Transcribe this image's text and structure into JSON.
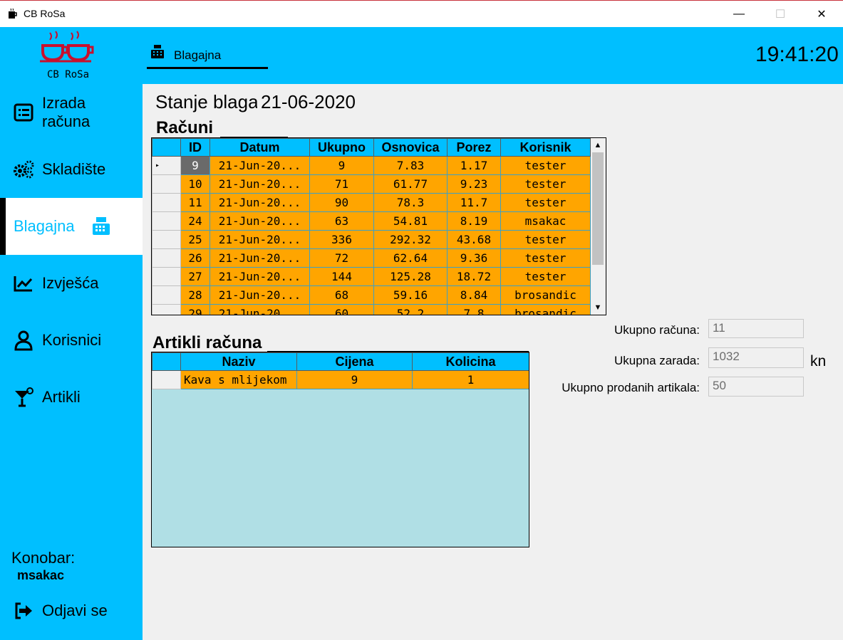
{
  "window": {
    "title": "CB RoSa",
    "minimize": "—",
    "maximize": "☐",
    "close": "✕"
  },
  "logo": {
    "text": "CB RoSa"
  },
  "sidebar": {
    "items": [
      {
        "label_line1": "Izrada",
        "label_line2": "računa",
        "icon": "list-icon"
      },
      {
        "label": "Skladište",
        "icon": "gears-icon"
      },
      {
        "label": "Blagajna",
        "icon": "cash-register-icon",
        "active": true
      },
      {
        "label": "Izvješća",
        "icon": "chart-icon"
      },
      {
        "label": "Korisnici",
        "icon": "user-icon"
      },
      {
        "label": "Artikli",
        "icon": "cocktail-icon"
      }
    ],
    "waiter_label": "Konobar:",
    "waiter_name": "msakac",
    "logout_label": "Odjavi se"
  },
  "header": {
    "tab_label": "Blagajna",
    "clock": "19:41:20"
  },
  "main": {
    "stanje_label": "Stanje blaga",
    "date": "21-06-2020",
    "racuni_title": "Računi",
    "racuni_columns": [
      "ID",
      "Datum",
      "Ukupno",
      "Osnovica",
      "Porez",
      "Korisnik"
    ],
    "racuni_rows": [
      [
        "9",
        "21-Jun-20...",
        "9",
        "7.83",
        "1.17",
        "tester"
      ],
      [
        "10",
        "21-Jun-20...",
        "71",
        "61.77",
        "9.23",
        "tester"
      ],
      [
        "11",
        "21-Jun-20...",
        "90",
        "78.3",
        "11.7",
        "tester"
      ],
      [
        "24",
        "21-Jun-20...",
        "63",
        "54.81",
        "8.19",
        "msakac"
      ],
      [
        "25",
        "21-Jun-20...",
        "336",
        "292.32",
        "43.68",
        "tester"
      ],
      [
        "26",
        "21-Jun-20...",
        "72",
        "62.64",
        "9.36",
        "tester"
      ],
      [
        "27",
        "21-Jun-20...",
        "144",
        "125.28",
        "18.72",
        "tester"
      ],
      [
        "28",
        "21-Jun-20...",
        "68",
        "59.16",
        "8.84",
        "brosandic"
      ],
      [
        "29",
        "21-Jun-20...",
        "60",
        "52.2",
        "7.8",
        "brosandic"
      ]
    ],
    "artikli_title": "Artikli računa",
    "artikli_columns": [
      "Naziv",
      "Cijena",
      "Kolicina"
    ],
    "artikli_rows": [
      [
        "Kava s mlijekom",
        "9",
        "1"
      ]
    ],
    "summary": {
      "ukupno_racuna_label": "Ukupno računa:",
      "ukupno_racuna": "11",
      "ukupna_zarada_label": "Ukupna zarada:",
      "ukupna_zarada": "1032",
      "currency": "kn",
      "ukupno_artikala_label": "Ukupno prodanih artikala:",
      "ukupno_artikala": "50"
    }
  },
  "colors": {
    "accent": "#00bfff",
    "row": "#ffa500",
    "empty_grid": "#b0dfe5",
    "logo_red": "#c8102e"
  }
}
